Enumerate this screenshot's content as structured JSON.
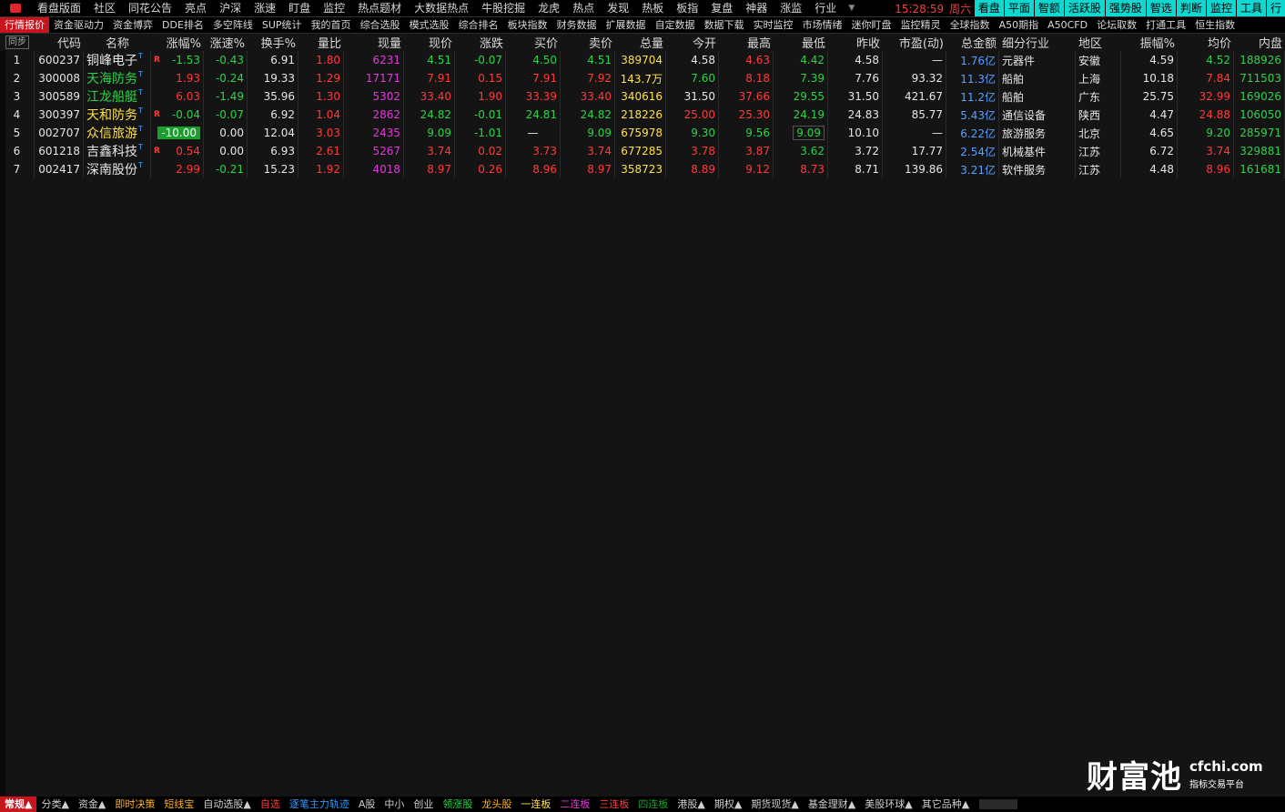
{
  "menubar": {
    "items": [
      "看盘版面",
      "社区",
      "同花公告",
      "亮点",
      "沪深",
      "涨速",
      "盯盘",
      "监控",
      "热点题材",
      "大数据热点",
      "牛股挖掘",
      "龙虎",
      "热点",
      "发现",
      "热板",
      "板指",
      "复盘",
      "神器",
      "涨监",
      "行业"
    ],
    "clock_time": "15:28:59",
    "clock_day": "周六",
    "right_tools": [
      "看盘",
      "平面",
      "智额",
      "活跃股",
      "强势股",
      "智选",
      "判断",
      "监控",
      "工具",
      "行"
    ]
  },
  "tabs": [
    "行情报价",
    "资金驱动力",
    "资金博弈",
    "DDE排名",
    "多空阵线",
    "SUP统计",
    "我的首页",
    "综合选股",
    "模式选股",
    "综合排名",
    "板块指数",
    "财务数据",
    "扩展数据",
    "自定数据",
    "数据下载",
    "实时监控",
    "市场情绪",
    "迷你盯盘",
    "监控精灵",
    "全球指数",
    "A50期指",
    "A50CFD",
    "论坛取数",
    "打通工具",
    "恒生指数"
  ],
  "table": {
    "sync_label": "同步",
    "columns": [
      "代码",
      "名称",
      "涨幅%",
      "涨速%",
      "换手%",
      "量比",
      "现量",
      "现价",
      "涨跌",
      "买价",
      "卖价",
      "总量",
      "今开",
      "最高",
      "最低",
      "昨收",
      "市盈(动)",
      "总金额",
      "细分行业",
      "地区",
      "振幅%",
      "均价",
      "内盘"
    ],
    "rows": [
      {
        "idx": "1",
        "code": "600237",
        "name": "铜峰电子",
        "name_color": "white",
        "t": "T",
        "r": "R",
        "chg": "-1.53",
        "spd": "-0.43",
        "turn": "6.91",
        "vr": "1.80",
        "cur": "6231",
        "price": "4.51",
        "diff": "-0.07",
        "bid": "4.50",
        "ask": "4.51",
        "vol": "389704",
        "open": "4.58",
        "high": "4.63",
        "low": "4.42",
        "prev": "4.58",
        "pe": "—",
        "amt": "1.76亿",
        "ind": "元器件",
        "region": "安徽",
        "amp": "4.59",
        "avg": "4.52",
        "inner": "188926"
      },
      {
        "idx": "2",
        "code": "300008",
        "name": "天海防务",
        "name_color": "green",
        "t": "T",
        "r": "",
        "chg": "1.93",
        "spd": "-0.24",
        "turn": "19.33",
        "vr": "1.29",
        "cur": "17171",
        "price": "7.91",
        "diff": "0.15",
        "bid": "7.91",
        "ask": "7.92",
        "vol": "143.7万",
        "open": "7.60",
        "high": "8.18",
        "low": "7.39",
        "prev": "7.76",
        "pe": "93.32",
        "amt": "11.3亿",
        "ind": "船舶",
        "region": "上海",
        "amp": "10.18",
        "avg": "7.84",
        "inner": "711503"
      },
      {
        "idx": "3",
        "code": "300589",
        "name": "江龙船艇",
        "name_color": "green",
        "t": "T",
        "r": "",
        "chg": "6.03",
        "spd": "-1.49",
        "turn": "35.96",
        "vr": "1.30",
        "cur": "5302",
        "price": "33.40",
        "diff": "1.90",
        "bid": "33.39",
        "ask": "33.40",
        "vol": "340616",
        "open": "31.50",
        "high": "37.66",
        "low": "29.55",
        "prev": "31.50",
        "pe": "421.67",
        "amt": "11.2亿",
        "ind": "船舶",
        "region": "广东",
        "amp": "25.75",
        "avg": "32.99",
        "inner": "169026"
      },
      {
        "idx": "4",
        "code": "300397",
        "name": "天和防务",
        "name_color": "yellow",
        "t": "T",
        "r": "R",
        "chg": "-0.04",
        "spd": "-0.07",
        "turn": "6.92",
        "vr": "1.04",
        "cur": "2862",
        "price": "24.82",
        "diff": "-0.01",
        "bid": "24.81",
        "ask": "24.82",
        "vol": "218226",
        "open": "25.00",
        "high": "25.30",
        "low": "24.19",
        "prev": "24.83",
        "pe": "85.77",
        "amt": "5.43亿",
        "ind": "通信设备",
        "region": "陕西",
        "amp": "4.47",
        "avg": "24.88",
        "inner": "106050"
      },
      {
        "idx": "5",
        "code": "002707",
        "name": "众信旅游",
        "name_color": "yellow",
        "t": "T",
        "r": "",
        "chg": "-10.00",
        "spd": "0.00",
        "turn": "12.04",
        "vr": "3.03",
        "cur": "2435",
        "price": "9.09",
        "diff": "-1.01",
        "bid": "—",
        "ask": "9.09",
        "vol": "675978",
        "open": "9.30",
        "high": "9.56",
        "low": "9.09",
        "prev": "10.10",
        "pe": "—",
        "amt": "6.22亿",
        "ind": "旅游服务",
        "region": "北京",
        "amp": "4.65",
        "avg": "9.20",
        "inner": "285971"
      },
      {
        "idx": "6",
        "code": "601218",
        "name": "吉鑫科技",
        "name_color": "white",
        "t": "T",
        "r": "R",
        "chg": "0.54",
        "spd": "0.00",
        "turn": "6.93",
        "vr": "2.61",
        "cur": "5267",
        "price": "3.74",
        "diff": "0.02",
        "bid": "3.73",
        "ask": "3.74",
        "vol": "677285",
        "open": "3.78",
        "high": "3.87",
        "low": "3.62",
        "prev": "3.72",
        "pe": "17.77",
        "amt": "2.54亿",
        "ind": "机械基件",
        "region": "江苏",
        "amp": "6.72",
        "avg": "3.74",
        "inner": "329881"
      },
      {
        "idx": "7",
        "code": "002417",
        "name": "深南股份",
        "name_color": "white",
        "t": "T",
        "r": "",
        "chg": "2.99",
        "spd": "-0.21",
        "turn": "15.23",
        "vr": "1.92",
        "cur": "4018",
        "price": "8.97",
        "diff": "0.26",
        "bid": "8.96",
        "ask": "8.97",
        "vol": "358723",
        "open": "8.89",
        "high": "9.12",
        "low": "8.73",
        "prev": "8.71",
        "pe": "139.86",
        "amt": "3.21亿",
        "ind": "软件服务",
        "region": "江苏",
        "amp": "4.48",
        "avg": "8.96",
        "inner": "161681"
      }
    ]
  },
  "brand": {
    "cn": "财富池",
    "domain": "cfchi.com",
    "tagline": "指标交易平台"
  },
  "bottombar": [
    {
      "label": "常规▲",
      "color": "#ffffff",
      "active": true
    },
    {
      "label": "分类▲",
      "color": "#cfcfcf"
    },
    {
      "label": "资金▲",
      "color": "#cfcfcf"
    },
    {
      "label": "即时决策",
      "color": "#ffb020"
    },
    {
      "label": "短线宝",
      "color": "#ffb020"
    },
    {
      "label": "自动选股▲",
      "color": "#cfcfcf"
    },
    {
      "label": "自选",
      "color": "#ff3b3b"
    },
    {
      "label": "逐笔主力轨迹",
      "color": "#2a9dff"
    },
    {
      "label": "A股",
      "color": "#cfcfcf"
    },
    {
      "label": "中小",
      "color": "#cfcfcf"
    },
    {
      "label": "创业",
      "color": "#cfcfcf"
    },
    {
      "label": "领涨股",
      "color": "#2fd24a"
    },
    {
      "label": "龙头股",
      "color": "#ffb020"
    },
    {
      "label": "一连板",
      "color": "#ffe14a"
    },
    {
      "label": "二连板",
      "color": "#e03ad8"
    },
    {
      "label": "三连板",
      "color": "#ff3b3b"
    },
    {
      "label": "四连板",
      "color": "#19a02a"
    },
    {
      "label": "港股▲",
      "color": "#cfcfcf"
    },
    {
      "label": "期权▲",
      "color": "#cfcfcf"
    },
    {
      "label": "期货现货▲",
      "color": "#cfcfcf"
    },
    {
      "label": "基金理财▲",
      "color": "#cfcfcf"
    },
    {
      "label": "美股环球▲",
      "color": "#cfcfcf"
    },
    {
      "label": "其它品种▲",
      "color": "#cfcfcf"
    }
  ]
}
